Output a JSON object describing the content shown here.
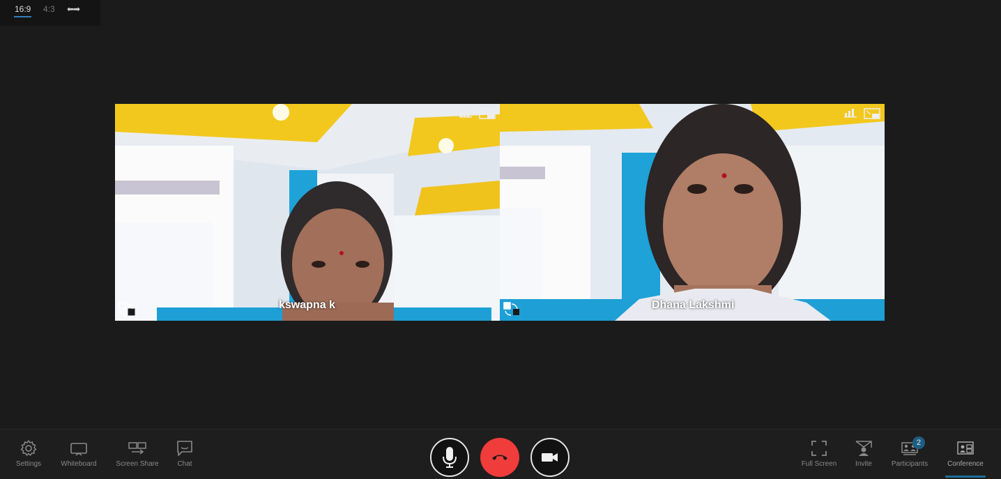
{
  "aspect": {
    "ratio_169": "16:9",
    "ratio_43": "4:3"
  },
  "participants": [
    {
      "name": "kswapna k"
    },
    {
      "name": "Dhana Lakshmi"
    }
  ],
  "toolbar": {
    "settings": "Settings",
    "whiteboard": "Whiteboard",
    "screen_share": "Screen Share",
    "chat": "Chat",
    "full_screen": "Full Screen",
    "invite": "Invite",
    "participants": "Participants",
    "participants_count": "2",
    "conference": "Conference"
  },
  "colors": {
    "background": "#1b1b1b",
    "hangup": "#f03c3a",
    "accent": "#1c6e97",
    "ceiling_yellow": "#f2c81e",
    "wall_blue": "#1ea2d8"
  }
}
